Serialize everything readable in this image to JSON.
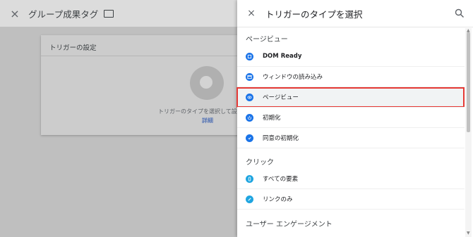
{
  "background": {
    "close": "×",
    "title": "グループ成果タグ",
    "card": {
      "title": "トリガーの設定",
      "help_text": "トリガーのタイプを選択して設定",
      "link": "詳細"
    }
  },
  "panel": {
    "close": "×",
    "title": "トリガーのタイプを選択",
    "sections": [
      {
        "title": "ページビュー",
        "items": [
          {
            "label": "DOM Ready",
            "icon": "code-icon",
            "color": "#1a73e8"
          },
          {
            "label": "ウィンドウの読み込み",
            "icon": "window-icon",
            "color": "#1a73e8"
          },
          {
            "label": "ページビュー",
            "icon": "eye-icon",
            "color": "#1a73e8",
            "selected": true
          },
          {
            "label": "初期化",
            "icon": "power-icon",
            "color": "#1a73e8"
          },
          {
            "label": "同意の初期化",
            "icon": "shield-check-icon",
            "color": "#1a73e8"
          }
        ]
      },
      {
        "title": "クリック",
        "items": [
          {
            "label": "すべての要素",
            "icon": "mouse-icon",
            "color": "#1fa5e0"
          },
          {
            "label": "リンクのみ",
            "icon": "link-icon",
            "color": "#1fa5e0"
          }
        ]
      },
      {
        "title": "ユーザー エンゲージメント",
        "items": []
      }
    ]
  },
  "colors": {
    "highlight_border": "#e53935",
    "pageview_icon": "#1a73e8",
    "click_icon": "#1fa5e0"
  }
}
